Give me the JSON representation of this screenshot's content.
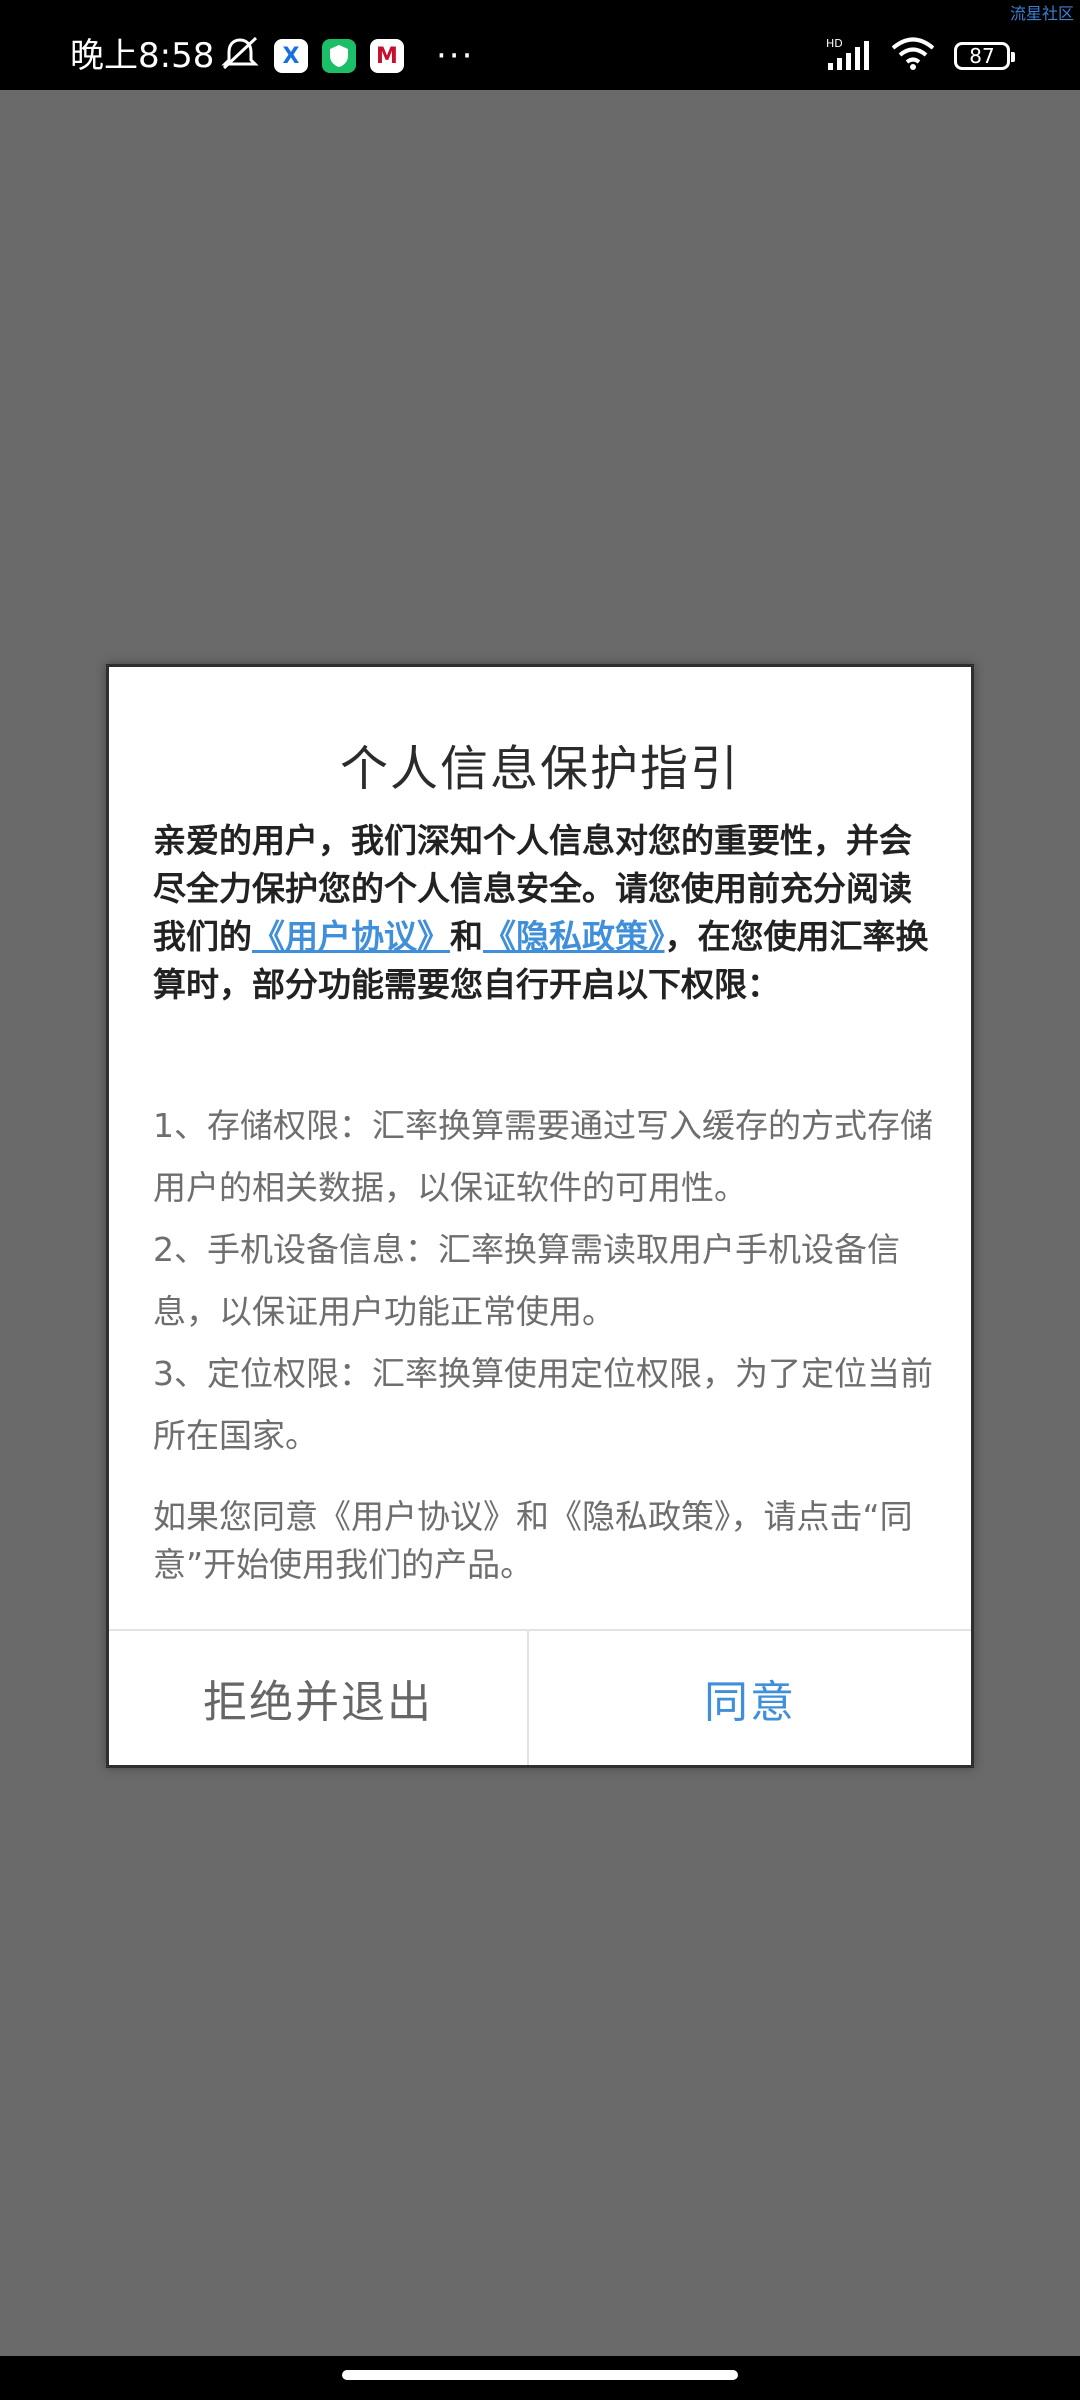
{
  "status_bar": {
    "time": "晚上8:58",
    "battery": "87",
    "network_label": "HD",
    "watermark": "流星社区",
    "icons": [
      "mute-bell-icon",
      "x-app-icon",
      "shield-app-icon",
      "bank-app-icon",
      "more-dots-icon",
      "signal-icon",
      "wifi-icon",
      "battery-icon"
    ]
  },
  "dialog": {
    "title": "个人信息保护指引",
    "intro": {
      "part1": "亲爱的用户，我们深知个人信息对您的重要性，并会尽全力保护您的个人信息安全。请您使用前充分阅读我们的",
      "link_agreement": "《用户协议》",
      "and": "和",
      "link_privacy": "《隐私政策》",
      "part2": "，在您使用汇率换算时，部分功能需要您自行开启以下权限："
    },
    "permissions": [
      "1、存储权限：汇率换算需要通过写入缓存的方式存储用户的相关数据，以保证软件的可用性。",
      "2、手机设备信息：汇率换算需读取用户手机设备信息，以保证用户功能正常使用。",
      "3、定位权限：汇率换算使用定位权限，为了定位当前所在国家。"
    ],
    "consent_text": "如果您同意《用户协议》和《隐私政策》，请点击“同意”开始使用我们的产品。",
    "reject_label": "拒绝并退出",
    "agree_label": "同意"
  },
  "colors": {
    "overlay": "#6a6a6a",
    "link": "#3f8fda",
    "agree": "#3f8fda"
  }
}
